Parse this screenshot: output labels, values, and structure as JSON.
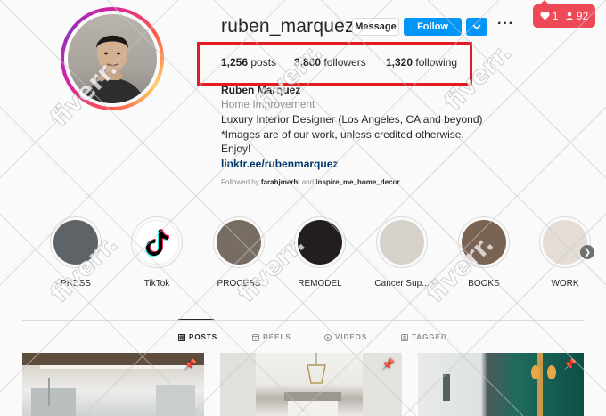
{
  "profile": {
    "username": "ruben_marquez",
    "message_label": "Message",
    "follow_label": "Follow",
    "more_label": "···",
    "stats": {
      "posts": {
        "count": "1,256",
        "label": "posts"
      },
      "followers": {
        "count": "3,860",
        "label": "followers"
      },
      "following": {
        "count": "1,320",
        "label": "following"
      }
    },
    "bio": {
      "name": "Ruben Marquez",
      "category": "Home Improvement",
      "line1": "Luxury Interior Designer (Los Angeles, CA and beyond)",
      "line2": "*Images are of our work, unless credited otherwise.",
      "line3": "Enjoy!",
      "link": "linktr.ee/rubenmarquez"
    },
    "followed_by": {
      "prefix": "Followed by",
      "user1": "farahjmerhi",
      "conj": "and",
      "user2": "inspire_me_home_decor"
    }
  },
  "notifications": {
    "likes": "1",
    "followers": "92",
    "color": "#ed4956"
  },
  "highlights": [
    {
      "label": "PRESS",
      "color": "#5d6366"
    },
    {
      "label": "TikTok",
      "color": "#000000"
    },
    {
      "label": "PROCESS",
      "color": "#776d62"
    },
    {
      "label": "REMODEL",
      "color": "#231d1e"
    },
    {
      "label": "Cancer Sup...",
      "color": "#d6d1cb"
    },
    {
      "label": "BOOKS",
      "color": "#7a6353"
    },
    {
      "label": "WORK",
      "color": "#e3ddd5"
    }
  ],
  "tabs": [
    {
      "label": "POSTS",
      "icon": "grid-icon"
    },
    {
      "label": "REELS",
      "icon": "reels-icon"
    },
    {
      "label": "VIDEOS",
      "icon": "video-icon"
    },
    {
      "label": "TAGGED",
      "icon": "tag-icon"
    }
  ],
  "watermark": "fiverr.",
  "colors": {
    "accent": "#0095f6",
    "highlight_box": "#e31b23"
  }
}
